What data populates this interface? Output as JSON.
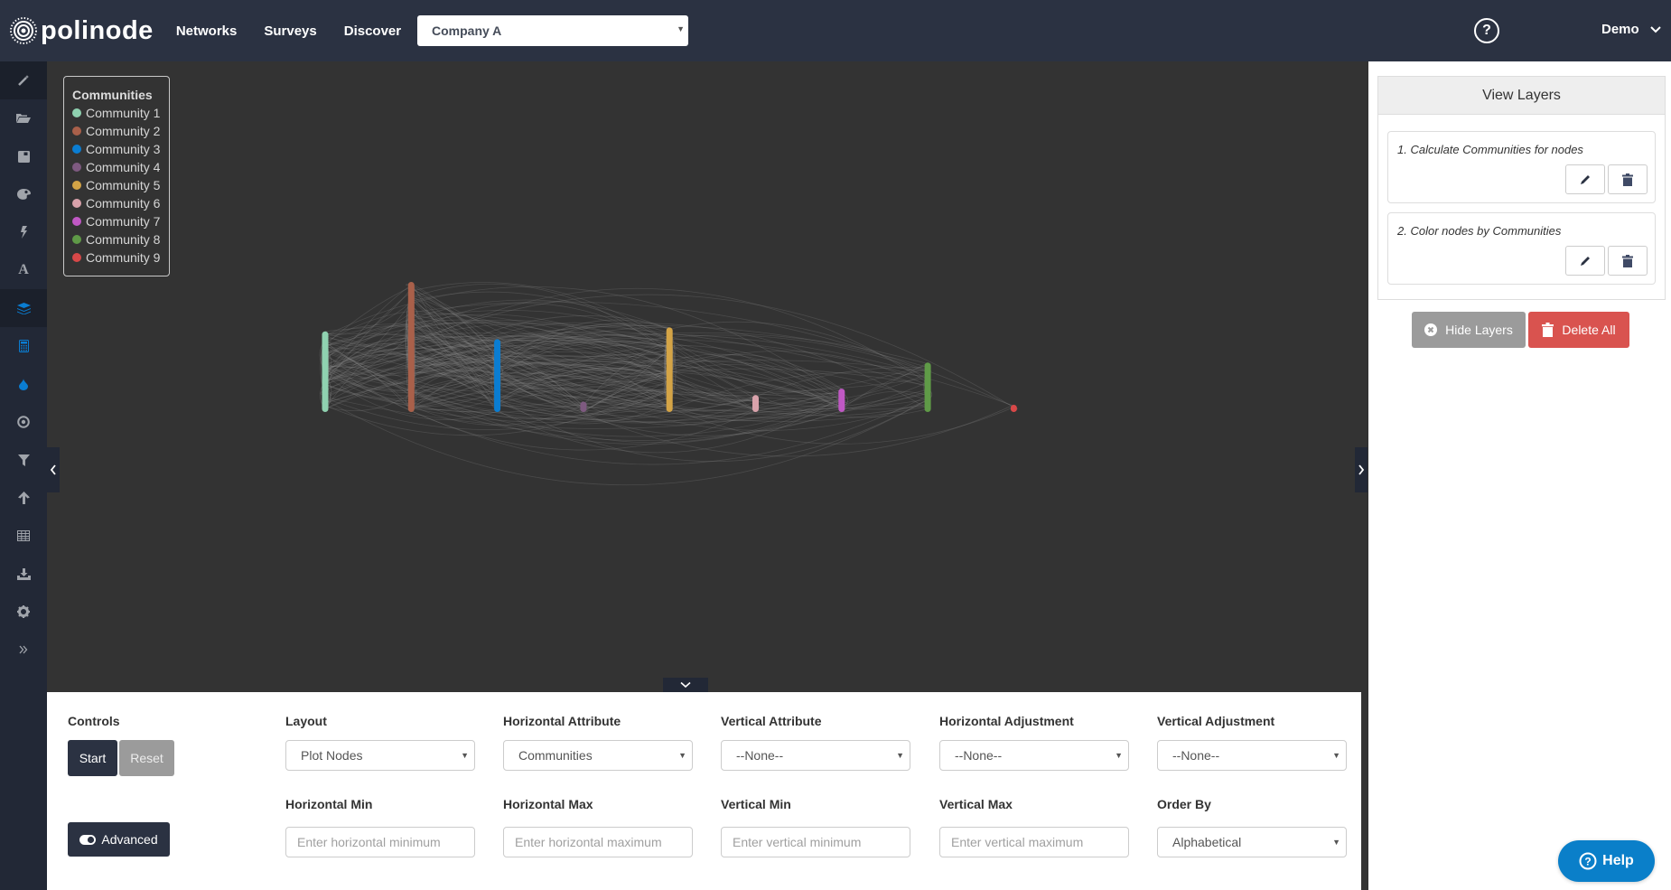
{
  "app": {
    "brand": "polinode",
    "nav": [
      "Networks",
      "Surveys",
      "Discover"
    ],
    "network_select": {
      "value": "Company A"
    },
    "help_icon": "question-circle-icon",
    "user": {
      "label": "Demo"
    }
  },
  "sidebar": {
    "items": [
      {
        "name": "magic-wand",
        "active": false
      },
      {
        "name": "folder-open",
        "active": false
      },
      {
        "name": "save",
        "active": false
      },
      {
        "name": "palette",
        "active": false
      },
      {
        "name": "bolt",
        "active": false
      },
      {
        "name": "font",
        "active": false
      },
      {
        "name": "layers",
        "active": true
      },
      {
        "name": "calculator",
        "active": false
      },
      {
        "name": "tint",
        "active": false
      },
      {
        "name": "dot-circle",
        "active": false
      },
      {
        "name": "filter",
        "active": false
      },
      {
        "name": "arrow-up",
        "active": false
      },
      {
        "name": "table",
        "active": false
      },
      {
        "name": "download",
        "active": false
      },
      {
        "name": "gear",
        "active": false
      },
      {
        "name": "double-chevron-right",
        "active": false
      }
    ]
  },
  "legend": {
    "title": "Communities",
    "items": [
      {
        "label": "Community 1",
        "color": "#8fd1b0"
      },
      {
        "label": "Community 2",
        "color": "#a9604a"
      },
      {
        "label": "Community 3",
        "color": "#0a7dd2"
      },
      {
        "label": "Community 4",
        "color": "#7e5a80"
      },
      {
        "label": "Community 5",
        "color": "#d4a446"
      },
      {
        "label": "Community 6",
        "color": "#d9a2ab"
      },
      {
        "label": "Community 7",
        "color": "#c058c4"
      },
      {
        "label": "Community 8",
        "color": "#5f9a47"
      },
      {
        "label": "Community 9",
        "color": "#d84848"
      }
    ]
  },
  "graph": {
    "community_node_extent": [
      {
        "community": "Community 1",
        "relative_height": 0.62
      },
      {
        "community": "Community 2",
        "relative_height": 1.0
      },
      {
        "community": "Community 3",
        "relative_height": 0.56
      },
      {
        "community": "Community 4",
        "relative_height": 0.08
      },
      {
        "community": "Community 5",
        "relative_height": 0.65
      },
      {
        "community": "Community 6",
        "relative_height": 0.13
      },
      {
        "community": "Community 7",
        "relative_height": 0.18
      },
      {
        "community": "Community 8",
        "relative_height": 0.38
      },
      {
        "community": "Community 9",
        "relative_height": 0.05
      }
    ]
  },
  "controls": {
    "title": "Controls",
    "start": "Start",
    "reset": "Reset",
    "advanced": "Advanced",
    "fields": {
      "layout": {
        "label": "Layout",
        "value": "Plot Nodes"
      },
      "horizontal_attribute": {
        "label": "Horizontal Attribute",
        "value": "Communities"
      },
      "vertical_attribute": {
        "label": "Vertical Attribute",
        "value": "--None--"
      },
      "horizontal_adjustment": {
        "label": "Horizontal Adjustment",
        "value": "--None--"
      },
      "vertical_adjustment": {
        "label": "Vertical Adjustment",
        "value": "--None--"
      },
      "horizontal_min": {
        "label": "Horizontal Min",
        "placeholder": "Enter horizontal minimum"
      },
      "horizontal_max": {
        "label": "Horizontal Max",
        "placeholder": "Enter horizontal maximum"
      },
      "vertical_min": {
        "label": "Vertical Min",
        "placeholder": "Enter vertical minimum"
      },
      "vertical_max": {
        "label": "Vertical Max",
        "placeholder": "Enter vertical maximum"
      },
      "order_by": {
        "label": "Order By",
        "value": "Alphabetical"
      }
    }
  },
  "layers_panel": {
    "title": "View Layers",
    "layers": [
      {
        "label": "1. Calculate Communities for nodes"
      },
      {
        "label": "2. Color nodes by Communities"
      }
    ],
    "hide_layers": "Hide Layers",
    "delete_all": "Delete All"
  },
  "help_button": {
    "label": "Help",
    "color": "#0a7fc9"
  },
  "colors": {
    "topbar": "#2b3242",
    "sidebar": "#222836",
    "canvas": "#333333",
    "active_icon": "#0a7dd2",
    "danger": "#d9534f"
  }
}
